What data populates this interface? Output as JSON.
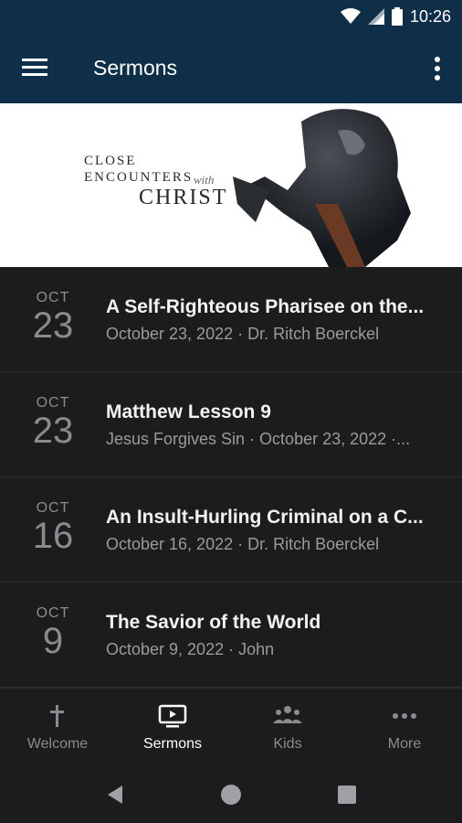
{
  "status_bar": {
    "time": "10:26"
  },
  "app_bar": {
    "title": "Sermons"
  },
  "banner": {
    "line1": "CLOSE",
    "line2": "ENCOUNTERS",
    "line_with": "with",
    "line3": "CHRIST"
  },
  "sermons": [
    {
      "month": "OCT",
      "day": "23",
      "title": "A Self-Righteous Pharisee on the...",
      "subtitle": "October 23, 2022 · Dr. Ritch Boerckel"
    },
    {
      "month": "OCT",
      "day": "23",
      "title": "Matthew Lesson 9",
      "subtitle": "Jesus Forgives Sin · October 23, 2022 ·..."
    },
    {
      "month": "OCT",
      "day": "16",
      "title": "An Insult-Hurling Criminal on a C...",
      "subtitle": "October 16, 2022 · Dr. Ritch Boerckel"
    },
    {
      "month": "OCT",
      "day": "9",
      "title": "The Savior of the World",
      "subtitle": "October 9, 2022 · John"
    }
  ],
  "bottom_nav": {
    "items": [
      {
        "label": "Welcome",
        "icon": "cross-icon",
        "active": false
      },
      {
        "label": "Sermons",
        "icon": "tv-icon",
        "active": true
      },
      {
        "label": "Kids",
        "icon": "group-icon",
        "active": false
      },
      {
        "label": "More",
        "icon": "more-horiz-icon",
        "active": false
      }
    ]
  },
  "colors": {
    "app_bar": "#0f2e48",
    "background": "#1b1c1e",
    "text_primary": "#f2f2f2",
    "text_secondary": "#9a9b9e"
  }
}
